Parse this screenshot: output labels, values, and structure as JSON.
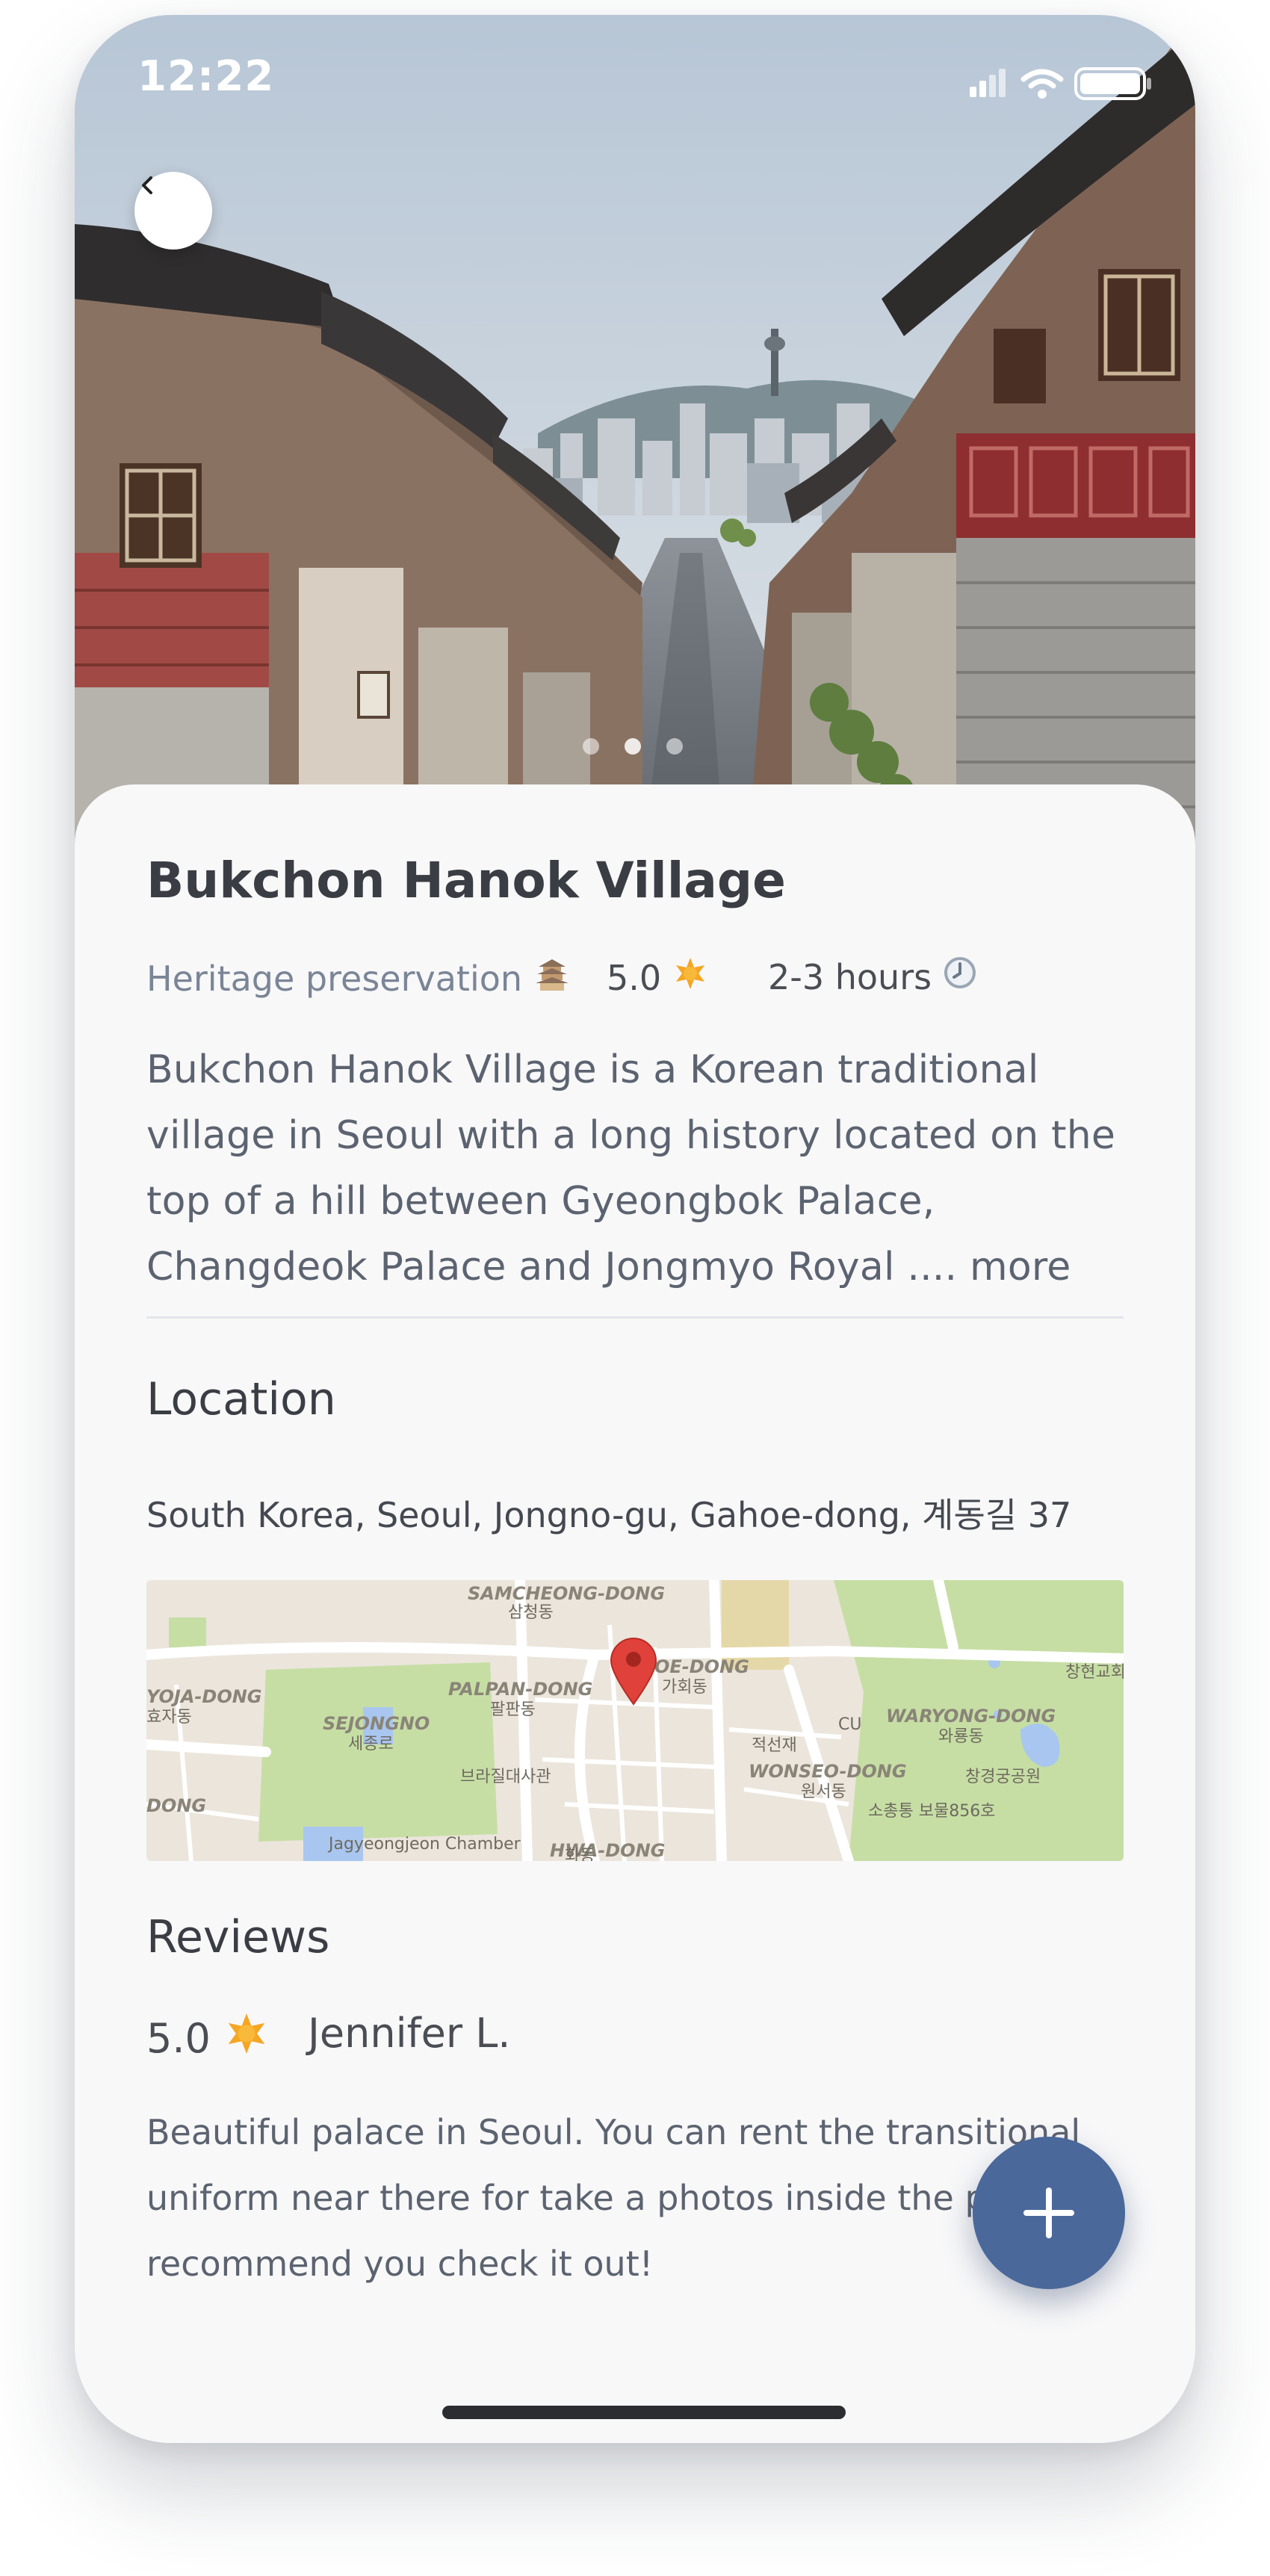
{
  "status_bar": {
    "time": "12:22"
  },
  "gallery": {
    "total_images": 3,
    "active_index": 1
  },
  "place": {
    "title": "Bukchon Hanok Village",
    "category": "Heritage preservation",
    "category_icon": "temple-icon",
    "rating": "5.0",
    "rating_icon": "star-icon",
    "duration": "2-3 hours",
    "duration_icon": "clock-icon",
    "description": "Bukchon Hanok Village is a Korean traditional village in Seoul with a long history located on the top of a hill between Gyeongbok Palace, Changdeok Palace and Jongmyo Royal",
    "more_label": ".... more"
  },
  "location": {
    "title": "Location",
    "address": "South Korea, Seoul, Jongno-gu, Gahoe-dong, 계동길 37",
    "map": {
      "labels": [
        "SAMCHEONG-DONG",
        "삼청동",
        "OE-DONG",
        "가회동",
        "PALPAN-DONG",
        "팔판동",
        "YOJA-DONG",
        "효자동",
        "SEJONGNO",
        "세종로",
        "브라질대사관",
        "적선재",
        "CU",
        "WARYONG-DONG",
        "와룡동",
        "WONSEO-DONG",
        "원서동",
        "창경궁공원",
        "소총통 보물856호",
        "창현교회",
        "DONG",
        "Jagyeongjeon Chamber",
        "HWA-DONG",
        "화동"
      ]
    }
  },
  "reviews": {
    "title": "Reviews",
    "items": [
      {
        "rating": "5.0",
        "author": "Jennifer L.",
        "text": "Beautiful palace in Seoul. You can rent the transitional uniform near there for take a photos inside the palace. I recommend you check it out!"
      }
    ]
  },
  "colors": {
    "accent": "#4b689b",
    "star": "#f5a623",
    "title_text": "#3a3d44",
    "muted_text": "#7a8596"
  }
}
